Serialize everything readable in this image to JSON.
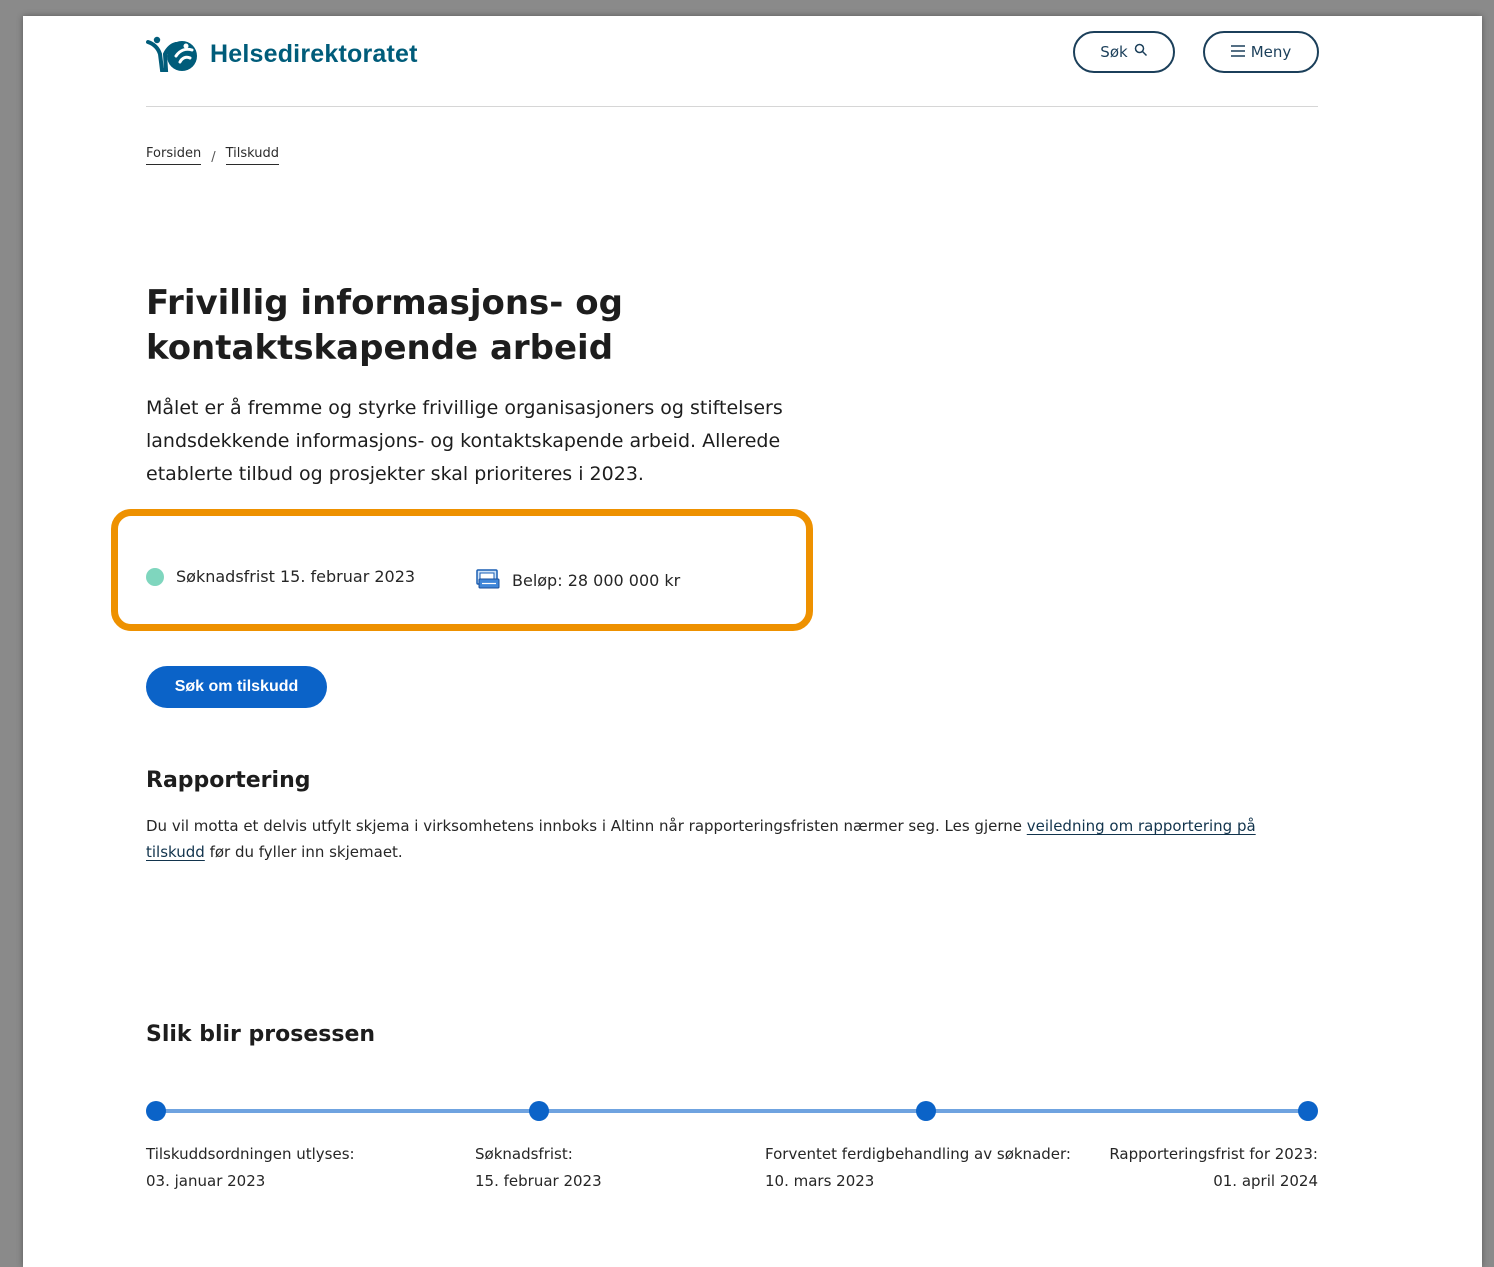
{
  "header": {
    "logo_text": "Helsedirektoratet",
    "search_label": "Søk",
    "menu_label": "Meny"
  },
  "breadcrumb": {
    "items": [
      "Forsiden",
      "Tilskudd"
    ],
    "separator": "/"
  },
  "main": {
    "title_line1": "Frivillig informasjons- og",
    "title_line2": "kontaktskapende arbeid",
    "lead": "Målet er å fremme og styrke frivillige organisasjoners og stiftelsers landsdekkende informasjons- og kontaktskapende arbeid. Allerede etablerte tilbud og prosjekter skal prioriteres i 2023.",
    "deadline_label": "Søknadsfrist 15. februar 2023",
    "amount_label": "Beløp: 28 000 000 kr",
    "apply_button": "Søk om tilskudd"
  },
  "reporting": {
    "heading": "Rapportering",
    "text_before": "Du vil motta et delvis utfylt skjema i virksomhetens innboks i Altinn når rapporteringsfristen nærmer seg. Les gjerne ",
    "link_text": "veiledning om rapportering på tilskudd",
    "text_after": " før du fyller inn skjemaet."
  },
  "process": {
    "heading": "Slik blir prosessen",
    "steps": [
      {
        "label": "Tilskuddsordningen utlyses:",
        "date": "03. januar 2023"
      },
      {
        "label": "Søknadsfrist:",
        "date": "15. februar 2023"
      },
      {
        "label": "Forventet ferdigbehandling av søknader:",
        "date": "10. mars 2023"
      },
      {
        "label": "Rapporteringsfrist for 2023:",
        "date": "01. april 2024"
      }
    ]
  },
  "colors": {
    "brand": "#005c7a",
    "primary_button": "#0b63c8",
    "highlight_border": "#ee9100",
    "deadline_dot": "#7fd6be",
    "timeline_line": "#6fa3e0"
  },
  "icons": [
    "logo-icon",
    "search-icon",
    "menu-icon",
    "status-dot-icon",
    "money-icon"
  ]
}
